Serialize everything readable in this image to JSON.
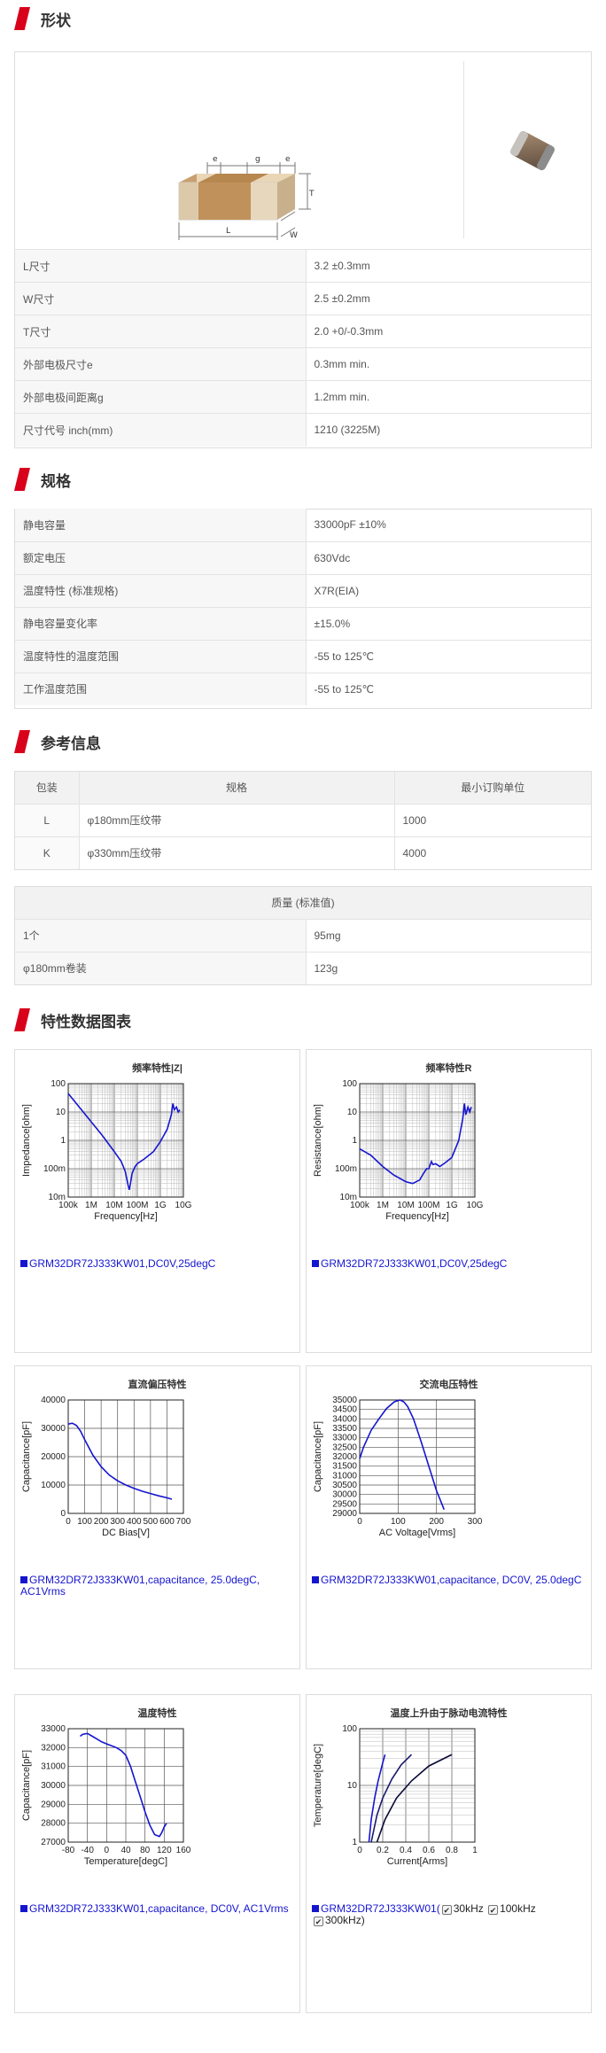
{
  "sections": {
    "shape": "形状",
    "spec": "规格",
    "ref": "参考信息",
    "charts": "特性数据图表"
  },
  "diagram": {
    "e1": "e",
    "g": "g",
    "e2": "e",
    "T": "T",
    "L": "L",
    "W": "W"
  },
  "shape_rows": [
    {
      "label": "L尺寸",
      "value": "3.2 ±0.3mm"
    },
    {
      "label": "W尺寸",
      "value": "2.5 ±0.2mm"
    },
    {
      "label": "T尺寸",
      "value": "2.0 +0/-0.3mm"
    },
    {
      "label": "外部电极尺寸e",
      "value": "0.3mm min."
    },
    {
      "label": "外部电极间距离g",
      "value": "1.2mm min."
    },
    {
      "label": "尺寸代号 inch(mm)",
      "value": "1210 (3225M)"
    }
  ],
  "spec_rows": [
    {
      "label": "静电容量",
      "value": "33000pF ±10%"
    },
    {
      "label": "额定电压",
      "value": "630Vdc"
    },
    {
      "label": "温度特性 (标准规格)",
      "value": "X7R(EIA)"
    },
    {
      "label": "静电容量变化率",
      "value": "±15.0%"
    },
    {
      "label": "温度特性的温度范围",
      "value": "-55 to 125℃"
    },
    {
      "label": "工作温度范围",
      "value": "-55 to 125℃"
    }
  ],
  "packaging": {
    "headers": [
      "包装",
      "规格",
      "最小订购单位"
    ],
    "rows": [
      {
        "code": "L",
        "spec": "φ180mm压纹带",
        "moq": "1000"
      },
      {
        "code": "K",
        "spec": "φ330mm压纹带",
        "moq": "4000"
      }
    ]
  },
  "mass": {
    "header": "质量 (标准值)",
    "rows": [
      {
        "label": "1个",
        "value": "95mg"
      },
      {
        "label": "φ180mm卷装",
        "value": "123g"
      }
    ]
  },
  "colors": {
    "accent": "#d9001b",
    "curve": "#1515d0",
    "curve_dark": "#1a1a6e"
  },
  "cards": [
    {
      "title": "频率特性|Z|",
      "legend": "GRM32DR72J333KW01,DC0V,25degC"
    },
    {
      "title": "频率特性R",
      "legend": "GRM32DR72J333KW01,DC0V,25degC"
    },
    {
      "title": "直流偏压特性",
      "legend": "GRM32DR72J333KW01,capacitance, 25.0degC, AC1Vrms"
    },
    {
      "title": "交流电压特性",
      "legend": "GRM32DR72J333KW01,capacitance, DC0V, 25.0degC"
    },
    {
      "title": "温度特性",
      "legend": "GRM32DR72J333KW01,capacitance, DC0V, AC1Vrms"
    },
    {
      "title": "温度上升由于脉动电流特性",
      "legend_base": "GRM32DR72J333KW01(",
      "legend_opts": [
        "30kHz",
        "100kHz",
        "300kHz)"
      ]
    }
  ],
  "chart_data": [
    {
      "type": "line",
      "title": "频率特性|Z|",
      "xlabel": "Frequency[Hz]",
      "ylabel": "Impedance[ohm]",
      "xscale": "log",
      "yscale": "log",
      "xlim": [
        100000,
        10000000000
      ],
      "ylim": [
        0.01,
        100
      ],
      "xticks": [
        "100k",
        "1M",
        "10M",
        "100M",
        "1G",
        "10G"
      ],
      "yticks": [
        "100",
        "10",
        "1",
        "100m",
        "10m"
      ],
      "x": [
        100000,
        300000,
        1000000,
        3000000,
        10000000,
        20000000,
        30000000,
        40000000,
        45000000,
        50000000,
        60000000,
        80000000,
        100000000,
        200000000,
        500000000,
        1000000000,
        2000000000,
        3000000000,
        3500000000,
        4000000000,
        5000000000,
        6000000000,
        7000000000
      ],
      "y": [
        45,
        15,
        4.5,
        1.5,
        0.4,
        0.18,
        0.08,
        0.025,
        0.018,
        0.03,
        0.07,
        0.12,
        0.15,
        0.22,
        0.4,
        0.9,
        2.5,
        8,
        20,
        12,
        15,
        10,
        12
      ]
    },
    {
      "type": "line",
      "title": "频率特性R",
      "xlabel": "Frequency[Hz]",
      "ylabel": "Resistance[ohm]",
      "xscale": "log",
      "yscale": "log",
      "xlim": [
        100000,
        10000000000
      ],
      "ylim": [
        0.01,
        100
      ],
      "xticks": [
        "100k",
        "1M",
        "10M",
        "100M",
        "1G",
        "10G"
      ],
      "yticks": [
        "100",
        "10",
        "1",
        "100m",
        "10m"
      ],
      "x": [
        100000,
        300000,
        1000000,
        3000000,
        10000000,
        20000000,
        40000000,
        60000000,
        80000000,
        100000000,
        130000000,
        150000000,
        200000000,
        300000000,
        500000000,
        1000000000,
        2000000000,
        3000000000,
        3500000000,
        4000000000,
        5000000000,
        6000000000,
        7000000000
      ],
      "y": [
        0.5,
        0.3,
        0.12,
        0.06,
        0.035,
        0.03,
        0.04,
        0.07,
        0.1,
        0.1,
        0.18,
        0.14,
        0.15,
        0.12,
        0.16,
        0.25,
        1,
        6,
        20,
        8,
        15,
        10,
        15
      ]
    },
    {
      "type": "line",
      "title": "直流偏压特性",
      "xlabel": "DC Bias[V]",
      "ylabel": "Capacitance[pF]",
      "xlim": [
        0,
        700
      ],
      "ylim": [
        0,
        40000
      ],
      "xticks": [
        "0",
        "100",
        "200",
        "300",
        "400",
        "500",
        "600",
        "700"
      ],
      "yticks": [
        "40000",
        "30000",
        "20000",
        "10000",
        "0"
      ],
      "x": [
        0,
        25,
        50,
        75,
        100,
        150,
        200,
        250,
        300,
        350,
        400,
        450,
        500,
        550,
        600,
        630
      ],
      "y": [
        31500,
        31800,
        31000,
        29000,
        26000,
        20500,
        16500,
        13500,
        11500,
        10000,
        8800,
        7800,
        7000,
        6200,
        5500,
        5000
      ]
    },
    {
      "type": "line",
      "title": "交流电压特性",
      "xlabel": "AC Voltage[Vrms]",
      "ylabel": "Capacitance[pF]",
      "xlim": [
        0,
        300
      ],
      "ylim": [
        29000,
        35000
      ],
      "xticks": [
        "0",
        "100",
        "200",
        "300"
      ],
      "yticks": [
        "35000",
        "34500",
        "34000",
        "33500",
        "33000",
        "32500",
        "32000",
        "31500",
        "31000",
        "30500",
        "30000",
        "29500",
        "29000"
      ],
      "x": [
        0,
        10,
        30,
        50,
        70,
        90,
        105,
        115,
        125,
        140,
        160,
        180,
        200,
        220
      ],
      "y": [
        31900,
        32500,
        33400,
        34000,
        34550,
        34900,
        35000,
        34900,
        34650,
        34000,
        32800,
        31500,
        30200,
        29200
      ]
    },
    {
      "type": "line",
      "title": "温度特性",
      "xlabel": "Temperature[degC]",
      "ylabel": "Capacitance[pF]",
      "xlim": [
        -80,
        160
      ],
      "ylim": [
        27000,
        33000
      ],
      "xticks": [
        "-80",
        "-40",
        "0",
        "40",
        "80",
        "120",
        "160"
      ],
      "yticks": [
        "33000",
        "32000",
        "31000",
        "30000",
        "29000",
        "28000",
        "27000"
      ],
      "x": [
        -55,
        -50,
        -40,
        -30,
        -20,
        -10,
        0,
        10,
        20,
        30,
        40,
        50,
        60,
        70,
        80,
        90,
        100,
        110,
        115,
        120,
        125
      ],
      "y": [
        32600,
        32700,
        32750,
        32600,
        32450,
        32300,
        32200,
        32100,
        32000,
        31850,
        31600,
        31000,
        30200,
        29400,
        28600,
        27900,
        27400,
        27300,
        27500,
        27800,
        28000
      ]
    },
    {
      "type": "line",
      "title": "温度上升由于脉动电流特性",
      "xlabel": "Current[Arms]",
      "ylabel": "Temperature[degC]",
      "xlim": [
        0,
        1
      ],
      "ylim": [
        1,
        100
      ],
      "yscale": "log",
      "xticks": [
        "0",
        "0.2",
        "0.4",
        "0.6",
        "0.8",
        "1"
      ],
      "yticks": [
        "100",
        "10",
        "1"
      ],
      "series": [
        {
          "name": "300kHz",
          "x": [
            0.08,
            0.1,
            0.13,
            0.16,
            0.2,
            0.22
          ],
          "y": [
            1,
            2.5,
            6,
            12,
            25,
            35
          ]
        },
        {
          "name": "100kHz",
          "x": [
            0.1,
            0.15,
            0.2,
            0.28,
            0.36,
            0.45
          ],
          "y": [
            1,
            3,
            6,
            13,
            23,
            35
          ]
        },
        {
          "name": "30kHz",
          "x": [
            0.15,
            0.22,
            0.32,
            0.45,
            0.6,
            0.8
          ],
          "y": [
            1,
            2.5,
            6,
            12,
            22,
            35
          ]
        }
      ]
    }
  ]
}
